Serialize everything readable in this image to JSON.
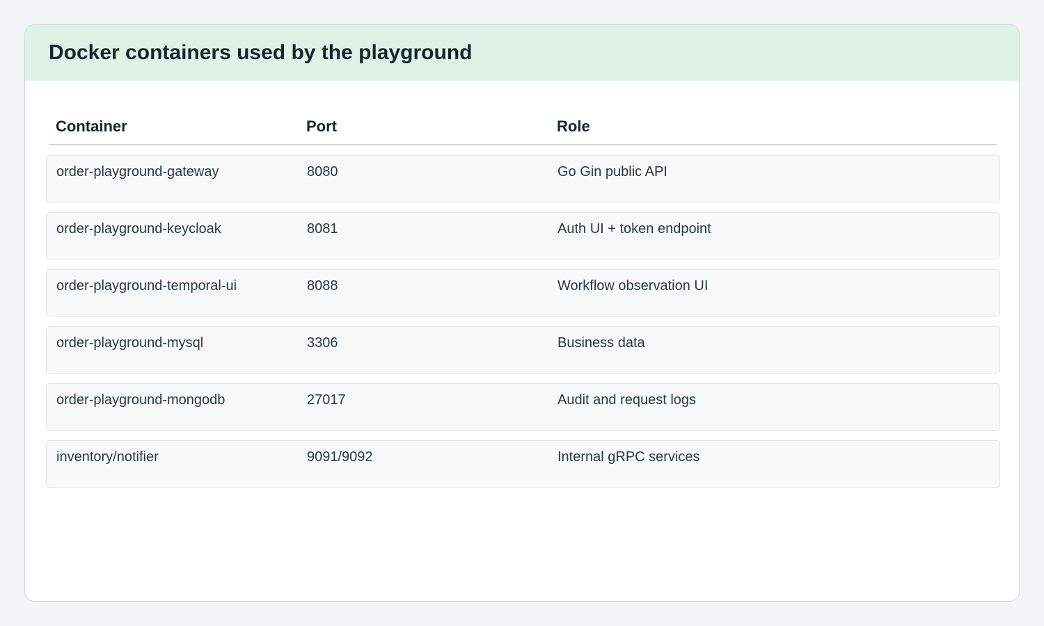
{
  "page": {
    "title": "Docker containers used by the playground"
  },
  "table": {
    "headers": {
      "container": "Container",
      "port": "Port",
      "role": "Role"
    },
    "rows": [
      {
        "container": "order-playground-gateway",
        "port": "8080",
        "role": "Go Gin public API"
      },
      {
        "container": "order-playground-keycloak",
        "port": "8081",
        "role": "Auth UI + token endpoint"
      },
      {
        "container": "order-playground-temporal-ui",
        "port": "8088",
        "role": "Workflow observation UI"
      },
      {
        "container": "order-playground-mysql",
        "port": "3306",
        "role": "Business data"
      },
      {
        "container": "order-playground-mongodb",
        "port": "27017",
        "role": "Audit and request logs"
      },
      {
        "container": "inventory/notifier",
        "port": "9091/9092",
        "role": "Internal gRPC services"
      }
    ]
  },
  "colors": {
    "header_background": "#dff2e6",
    "page_background": "#f3f6f7",
    "row_background": "#f8fafa"
  }
}
